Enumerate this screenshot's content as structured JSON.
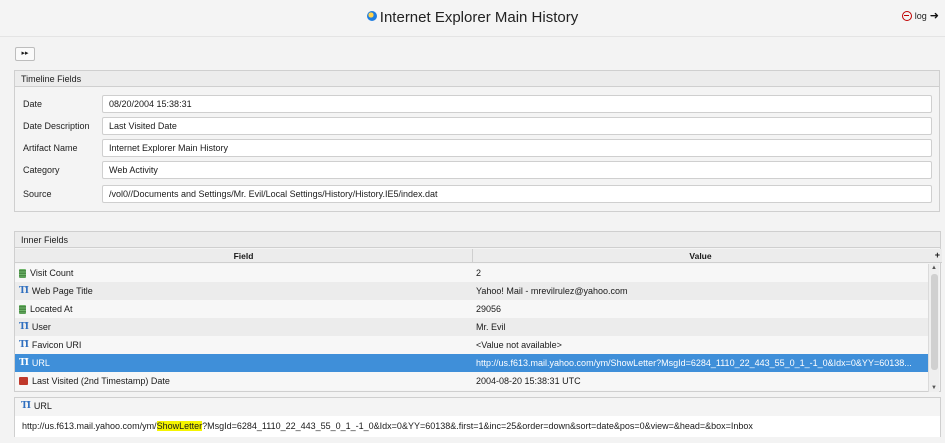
{
  "header": {
    "title": "Internet Explorer Main History",
    "log_label": "log"
  },
  "nav": {
    "forward_label": "▸▸"
  },
  "timeline": {
    "title": "Timeline Fields",
    "fields": [
      {
        "label": "Date",
        "value": "08/20/2004 15:38:31"
      },
      {
        "label": "Date Description",
        "value": "Last Visited Date"
      },
      {
        "label": "Artifact Name",
        "value": "Internet Explorer Main History"
      },
      {
        "label": "Category",
        "value": "Web Activity"
      },
      {
        "label": "Source",
        "value": "/vol0//Documents and Settings/Mr. Evil/Local Settings/History/History.IE5/index.dat"
      }
    ]
  },
  "inner": {
    "title": "Inner Fields",
    "col_field": "Field",
    "col_value": "Value",
    "add_col": "+",
    "rows": [
      {
        "field": "Visit Count",
        "value": "2",
        "icon": "number-icon"
      },
      {
        "field": "Web Page Title",
        "value": "Yahoo! Mail - mrevilrulez@yahoo.com",
        "icon": "text-icon"
      },
      {
        "field": "Located At",
        "value": "29056",
        "icon": "number-icon"
      },
      {
        "field": "User",
        "value": "Mr. Evil",
        "icon": "text-icon"
      },
      {
        "field": "Favicon URI",
        "value": "<Value not available>",
        "icon": "text-icon"
      },
      {
        "field": "URL",
        "value": "http://us.f613.mail.yahoo.com/ym/ShowLetter?MsgId=6284_1110_22_443_55_0_1_-1_0&Idx=0&YY=60138...",
        "icon": "text-icon",
        "selected": true
      },
      {
        "field": "Last Visited (2nd Timestamp) Date",
        "value": "2004-08-20 15:38:31 UTC",
        "icon": "calendar-icon"
      }
    ]
  },
  "url_panel": {
    "title": "URL",
    "value_before": "http://us.f613.mail.yahoo.com/ym/",
    "value_highlight": "ShowLetter",
    "value_after": "?MsgId=6284_1110_22_443_55_0_1_-1_0&Idx=0&YY=60138&.first=1&inc=25&order=down&sort=date&pos=0&view=&head=&box=Inbox",
    "highlight_color": "#f5f500"
  },
  "colors": {
    "selection": "#3f8fd9",
    "accent_red": "#c00000"
  }
}
